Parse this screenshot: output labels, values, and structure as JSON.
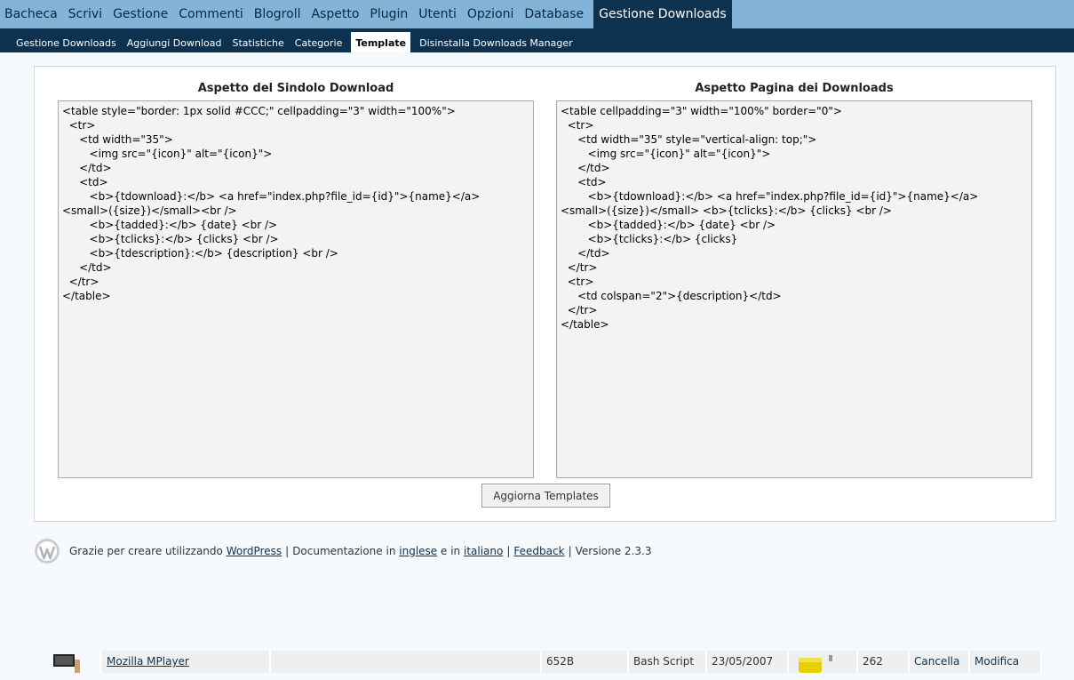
{
  "menu": {
    "items": [
      "Bacheca",
      "Scrivi",
      "Gestione",
      "Commenti",
      "Blogroll",
      "Aspetto",
      "Plugin",
      "Utenti",
      "Opzioni",
      "Database"
    ],
    "current": "Gestione Downloads"
  },
  "submenu": {
    "items": [
      "Gestione Downloads",
      "Aggiungi Download",
      "Statistiche",
      "Categorie"
    ],
    "current": "Template",
    "after": "Disinstalla Downloads Manager"
  },
  "panels": {
    "single_title": "Aspetto del Sindolo Download",
    "single_code": "<table style=\"border: 1px solid #CCC;\" cellpadding=\"3\" width=\"100%\">\n  <tr>\n     <td width=\"35\">\n        <img src=\"{icon}\" alt=\"{icon}\">\n     </td>\n     <td>\n        <b>{tdownload}:</b> <a href=\"index.php?file_id={id}\">{name}</a>\n<small>({size})</small><br />\n        <b>{tadded}:</b> {date} <br />\n        <b>{tclicks}:</b> {clicks} <br />\n        <b>{tdescription}:</b> {description} <br />\n     </td>\n  </tr>\n</table>",
    "page_title": "Aspetto Pagina dei Downloads",
    "page_code": "<table cellpadding=\"3\" width=\"100%\" border=\"0\">\n  <tr>\n     <td width=\"35\" style=\"vertical-align: top;\">\n        <img src=\"{icon}\" alt=\"{icon}\">\n     </td>\n     <td>\n        <b>{tdownload}:</b> <a href=\"index.php?file_id={id}\">{name}</a>\n<small>({size})</small> <b>{tclicks}:</b> {clicks} <br />\n        <b>{tadded}:</b> {date} <br />\n        <b>{tclicks}:</b> {clicks}\n     </td>\n  </tr>\n  <tr>\n     <td colspan=\"2\">{description}</td>\n  </tr>\n</table>",
    "button_label": "Aggiorna Templates"
  },
  "footer": {
    "text1": "Grazie per creare utilizzando",
    "wordpress_link": "WordPress",
    "sep": "|",
    "text2": "Documentazione in",
    "english_link": "inglese",
    "text3": "e in",
    "italian_link": "italiano",
    "feedback_link": "Feedback",
    "version": "Versione 2.3.3"
  },
  "bottom_row": {
    "name": "Mozilla MPlayer",
    "size": "652B",
    "type": "Bash Script",
    "date": "23/05/2007",
    "clicks": "262",
    "delete": "Cancella",
    "edit": "Modifica"
  },
  "colors": {
    "menu_bg": "#83b4d8",
    "submenu_bg": "#0d324f",
    "page_bg": "#f7fafc"
  }
}
